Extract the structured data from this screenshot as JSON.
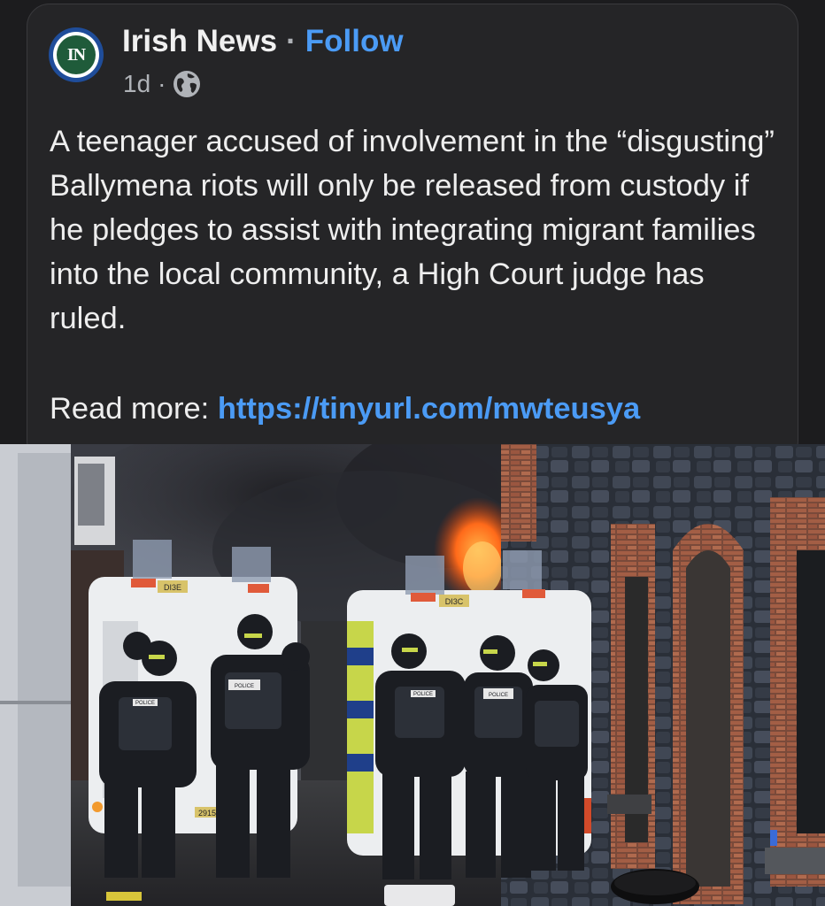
{
  "post": {
    "author": "Irish News",
    "separator": "·",
    "follow_label": "Follow",
    "timestamp": "1d",
    "meta_separator": "·",
    "privacy_icon": "globe-icon",
    "avatar_text": "IN",
    "body": "A teenager accused of involvement in the “disgusting” Ballymena riots will only be released from custody if he pledges to assist with integrating migrant families into the local community, a High Court judge has ruled.",
    "read_more_label": "Read more: ",
    "read_more_link": "https://tinyurl.com/mwteusya"
  },
  "photo": {
    "left_van_plate": "DI3E",
    "left_van_reg": "2915",
    "right_van_plate": "DI3C",
    "vest_label": "POLICE"
  },
  "colors": {
    "background": "#1c1c1e",
    "card": "#252527",
    "link": "#4b9bf5",
    "text": "#eeeeee",
    "muted": "#b0b3b8",
    "avatar_ring": "#1f4d9a",
    "avatar_core": "#1f5b3a"
  }
}
